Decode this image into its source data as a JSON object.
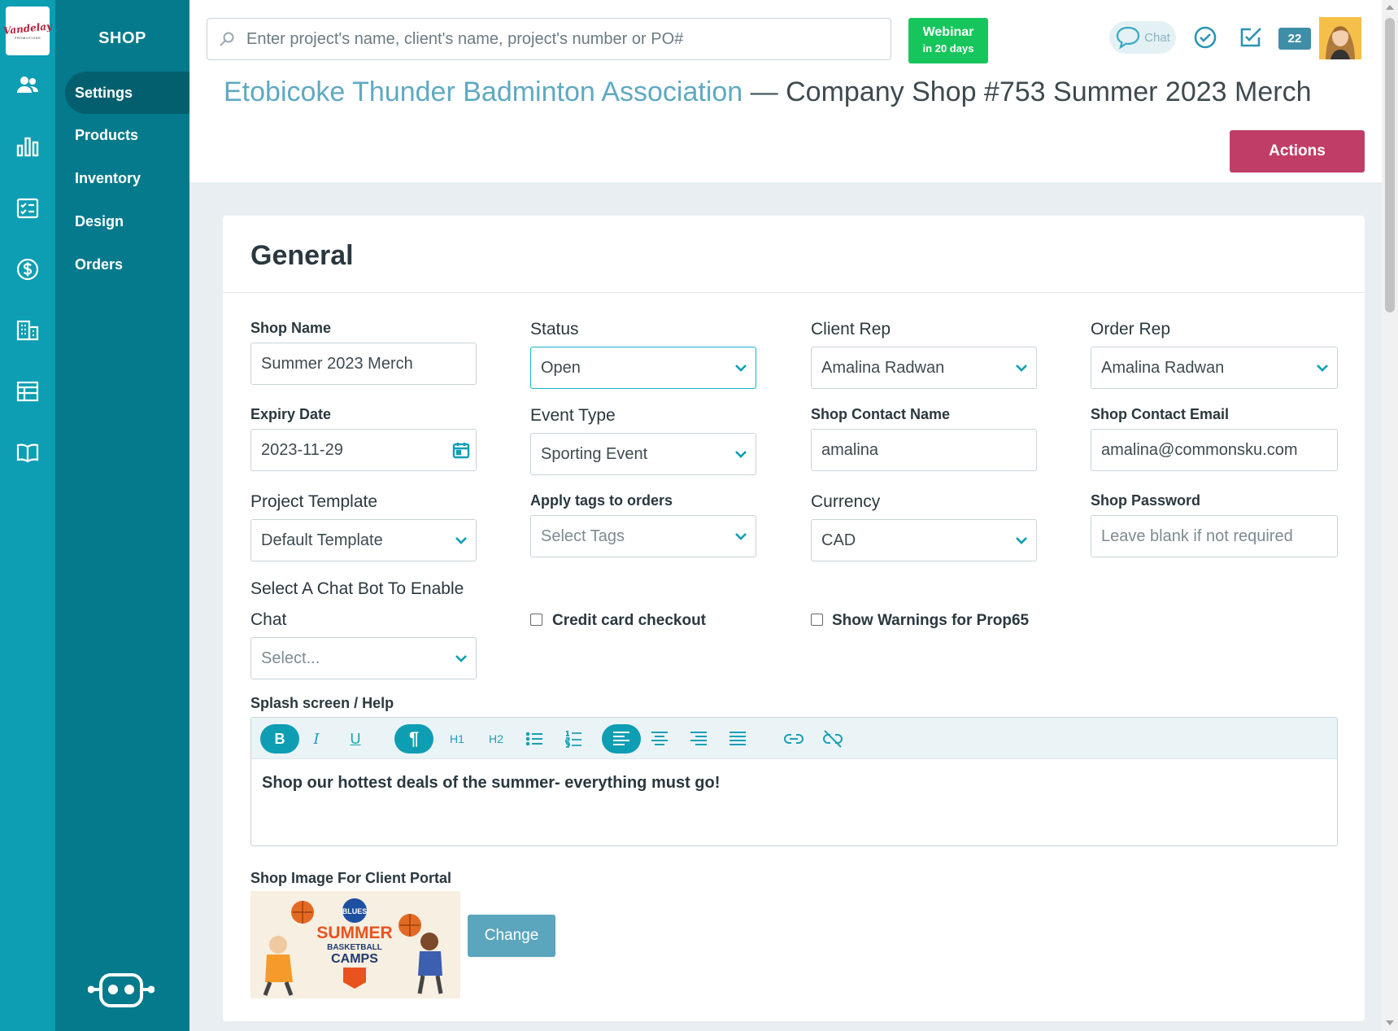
{
  "logo": {
    "text": "Vandelay",
    "subtext": "PROMOTIONS"
  },
  "nav": {
    "section_title": "SHOP",
    "items": [
      {
        "label": "Settings",
        "active": true
      },
      {
        "label": "Products",
        "active": false
      },
      {
        "label": "Inventory",
        "active": false
      },
      {
        "label": "Design",
        "active": false
      },
      {
        "label": "Orders",
        "active": false
      }
    ]
  },
  "header": {
    "search_placeholder": "Enter project's name, client's name, project's number or PO#",
    "webinar_title": "Webinar",
    "webinar_sub": "in 20 days",
    "chat_label": "Chat",
    "notification_count": "22",
    "client_name": "Etobicoke Thunder Badminton Association",
    "separator": "—",
    "shop_title": "Company Shop #753 Summer 2023 Merch",
    "actions_label": "Actions"
  },
  "general": {
    "title": "General",
    "shop_name": {
      "label": "Shop Name",
      "value": "Summer 2023 Merch"
    },
    "status": {
      "label": "Status",
      "value": "Open"
    },
    "client_rep": {
      "label": "Client Rep",
      "value": "Amalina Radwan"
    },
    "order_rep": {
      "label": "Order Rep",
      "value": "Amalina Radwan"
    },
    "expiry_date": {
      "label": "Expiry Date",
      "value": "2023-11-29"
    },
    "event_type": {
      "label": "Event Type",
      "value": "Sporting Event"
    },
    "contact_name": {
      "label": "Shop Contact Name",
      "value": "amalina"
    },
    "contact_email": {
      "label": "Shop Contact Email",
      "value": "amalina@commonsku.com"
    },
    "project_template": {
      "label": "Project Template",
      "value": "Default Template"
    },
    "tags": {
      "label": "Apply tags to orders",
      "placeholder": "Select Tags"
    },
    "currency": {
      "label": "Currency",
      "value": "CAD"
    },
    "password": {
      "label": "Shop Password",
      "placeholder": "Leave blank if not required"
    },
    "chat_bot": {
      "label_line1": "Select A Chat Bot To Enable",
      "label_line2": "Chat",
      "placeholder": "Select..."
    },
    "credit_card": {
      "label": "Credit card checkout",
      "checked": false
    },
    "prop65": {
      "label": "Show Warnings for Prop65",
      "checked": false
    },
    "splash": {
      "label": "Splash screen / Help",
      "toolbar": {
        "bold": "B",
        "italic": "I",
        "underline": "U",
        "paragraph": "¶",
        "h1": "H1",
        "h2": "H2"
      },
      "content": "Shop our hottest deals of the summer- everything must go!"
    },
    "shop_image": {
      "label": "Shop Image For Client Portal",
      "change_label": "Change",
      "image_text": {
        "brand": "BLUES",
        "line1": "SUMMER",
        "line2": "BASKETBALL",
        "line3": "CAMPS"
      }
    }
  },
  "colors": {
    "rail": "#0d9eb3",
    "subnav": "#047a8c",
    "accent": "#c03d68",
    "webinar": "#16c65c"
  }
}
